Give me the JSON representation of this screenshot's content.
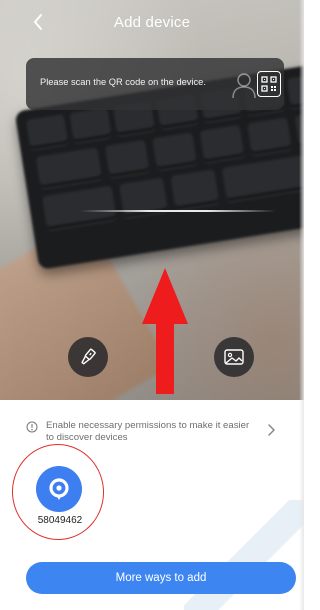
{
  "header": {
    "title": "Add device"
  },
  "scan_banner": {
    "text": "Please scan the QR code on the device."
  },
  "camera_controls": {
    "flash_icon": "flashlight-icon",
    "album_icon": "image-icon"
  },
  "permission_row": {
    "text": "Enable necessary permissions to make it easier to discover devices"
  },
  "discovered_devices": [
    {
      "id": "58049462",
      "icon": "device-ring-icon"
    }
  ],
  "footer": {
    "more_ways_label": "More ways to add"
  },
  "colors": {
    "accent": "#3d86f2",
    "device_icon_bg": "#3d7ff0",
    "annotation_red": "#e0302e"
  }
}
